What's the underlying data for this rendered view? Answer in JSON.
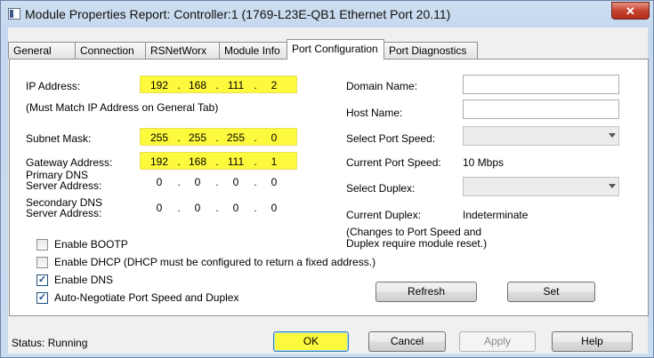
{
  "window": {
    "title": "Module Properties Report: Controller:1 (1769-L23E-QB1 Ethernet Port 20.11)",
    "close_label": "✕"
  },
  "tabs": [
    {
      "label": "General"
    },
    {
      "label": "Connection"
    },
    {
      "label": "RSNetWorx"
    },
    {
      "label": "Module Info"
    },
    {
      "label": "Port Configuration",
      "active": true
    },
    {
      "label": "Port Diagnostics"
    }
  ],
  "left": {
    "ip_label": "IP Address:",
    "ip": [
      "192",
      "168",
      "111",
      "2"
    ],
    "ip_note": "(Must Match IP Address on General Tab)",
    "subnet_label": "Subnet Mask:",
    "subnet": [
      "255",
      "255",
      "255",
      "0"
    ],
    "gateway_label": "Gateway Address:",
    "gateway": [
      "192",
      "168",
      "111",
      "1"
    ],
    "pdns_label_1": "Primary DNS",
    "pdns_label_2": "Server Address:",
    "pdns": [
      "0",
      "0",
      "0",
      "0"
    ],
    "sdns_label_1": "Secondary DNS",
    "sdns_label_2": "Server Address:",
    "sdns": [
      "0",
      "0",
      "0",
      "0"
    ],
    "dot": "."
  },
  "checks": {
    "bootp": {
      "label": "Enable BOOTP",
      "checked": false
    },
    "dhcp": {
      "label": "Enable DHCP  (DHCP must be configured to return a fixed address.)",
      "checked": false
    },
    "dns": {
      "label": "Enable DNS",
      "checked": true
    },
    "autoneg": {
      "label": "Auto-Negotiate Port Speed and Duplex",
      "checked": true
    },
    "check_glyph": "✓"
  },
  "right": {
    "domain_label": "Domain Name:",
    "domain_value": "",
    "host_label": "Host Name:",
    "host_value": "",
    "port_speed_label": "Select Port Speed:",
    "port_speed_value": "",
    "current_speed_label": "Current Port Speed:",
    "current_speed_value": "10 Mbps",
    "duplex_label": "Select Duplex:",
    "duplex_value": "",
    "current_duplex_label": "Current Duplex:",
    "current_duplex_value": "Indeterminate",
    "note_1": "(Changes to Port Speed and",
    "note_2": "Duplex require module reset.)",
    "refresh_label": "Refresh",
    "set_label": "Set"
  },
  "status": {
    "text": "Status:  Running",
    "ok_label": "OK",
    "cancel_label": "Cancel",
    "apply_label": "Apply",
    "help_label": "Help"
  },
  "colors": {
    "highlight": "#fdf93c",
    "titlebar": "#c5d8ee",
    "close": "#c74431"
  }
}
